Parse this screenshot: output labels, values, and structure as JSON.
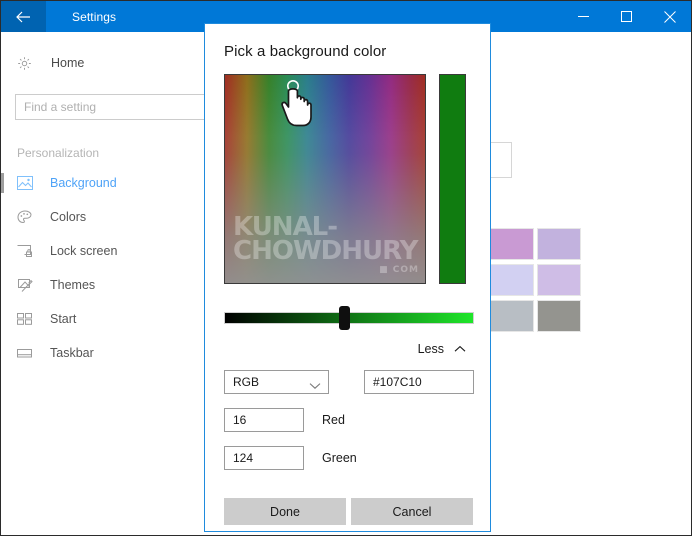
{
  "window": {
    "title": "Settings",
    "back_icon": "back-arrow-icon",
    "minimize_icon": "minimize-icon",
    "maximize_icon": "maximize-icon",
    "close_icon": "close-icon",
    "accent_color": "#0078d7",
    "back_button_color": "#0063b1"
  },
  "sidebar": {
    "home": {
      "label": "Home",
      "icon": "gear-icon"
    },
    "search": {
      "placeholder": "Find a setting",
      "value": ""
    },
    "group_label": "Personalization",
    "items": [
      {
        "label": "Background",
        "icon": "picture-icon",
        "selected": true
      },
      {
        "label": "Colors",
        "icon": "palette-icon",
        "selected": false
      },
      {
        "label": "Lock screen",
        "icon": "lock-screen-icon",
        "selected": false
      },
      {
        "label": "Themes",
        "icon": "themes-icon",
        "selected": false
      },
      {
        "label": "Start",
        "icon": "start-tiles-icon",
        "selected": false
      },
      {
        "label": "Taskbar",
        "icon": "taskbar-icon",
        "selected": false
      }
    ],
    "selected_text_color": "#4fa3f7"
  },
  "right_pane": {
    "swatches": [
      "#c99ad3",
      "#c2b2de",
      "#d2d0f2",
      "#cfbde6",
      "#b8bec4",
      "#94948f"
    ]
  },
  "dialog": {
    "title": "Pick a background color",
    "border_color": "#1f8bdd",
    "preview_color": "#107C10",
    "cursor_icon": "hand-pointer-cursor",
    "watermark": {
      "line1": "KUNAL-CHOWDHURY",
      "line2": "■ COM"
    },
    "brightness_slider": {
      "name": "brightness-slider",
      "value_percent": 48,
      "gradient_from": "#000000",
      "gradient_to": "#1fe62a"
    },
    "expand_toggle": {
      "label": "Less",
      "icon": "chevron-up-icon"
    },
    "mode_select": {
      "value": "RGB",
      "icon": "chevron-down-icon"
    },
    "hex_field": {
      "value": "#107C10"
    },
    "channels": [
      {
        "value": "16",
        "label": "Red"
      },
      {
        "value": "124",
        "label": "Green"
      }
    ],
    "buttons": [
      {
        "label": "Done",
        "name": "done-button"
      },
      {
        "label": "Cancel",
        "name": "cancel-button"
      }
    ]
  }
}
